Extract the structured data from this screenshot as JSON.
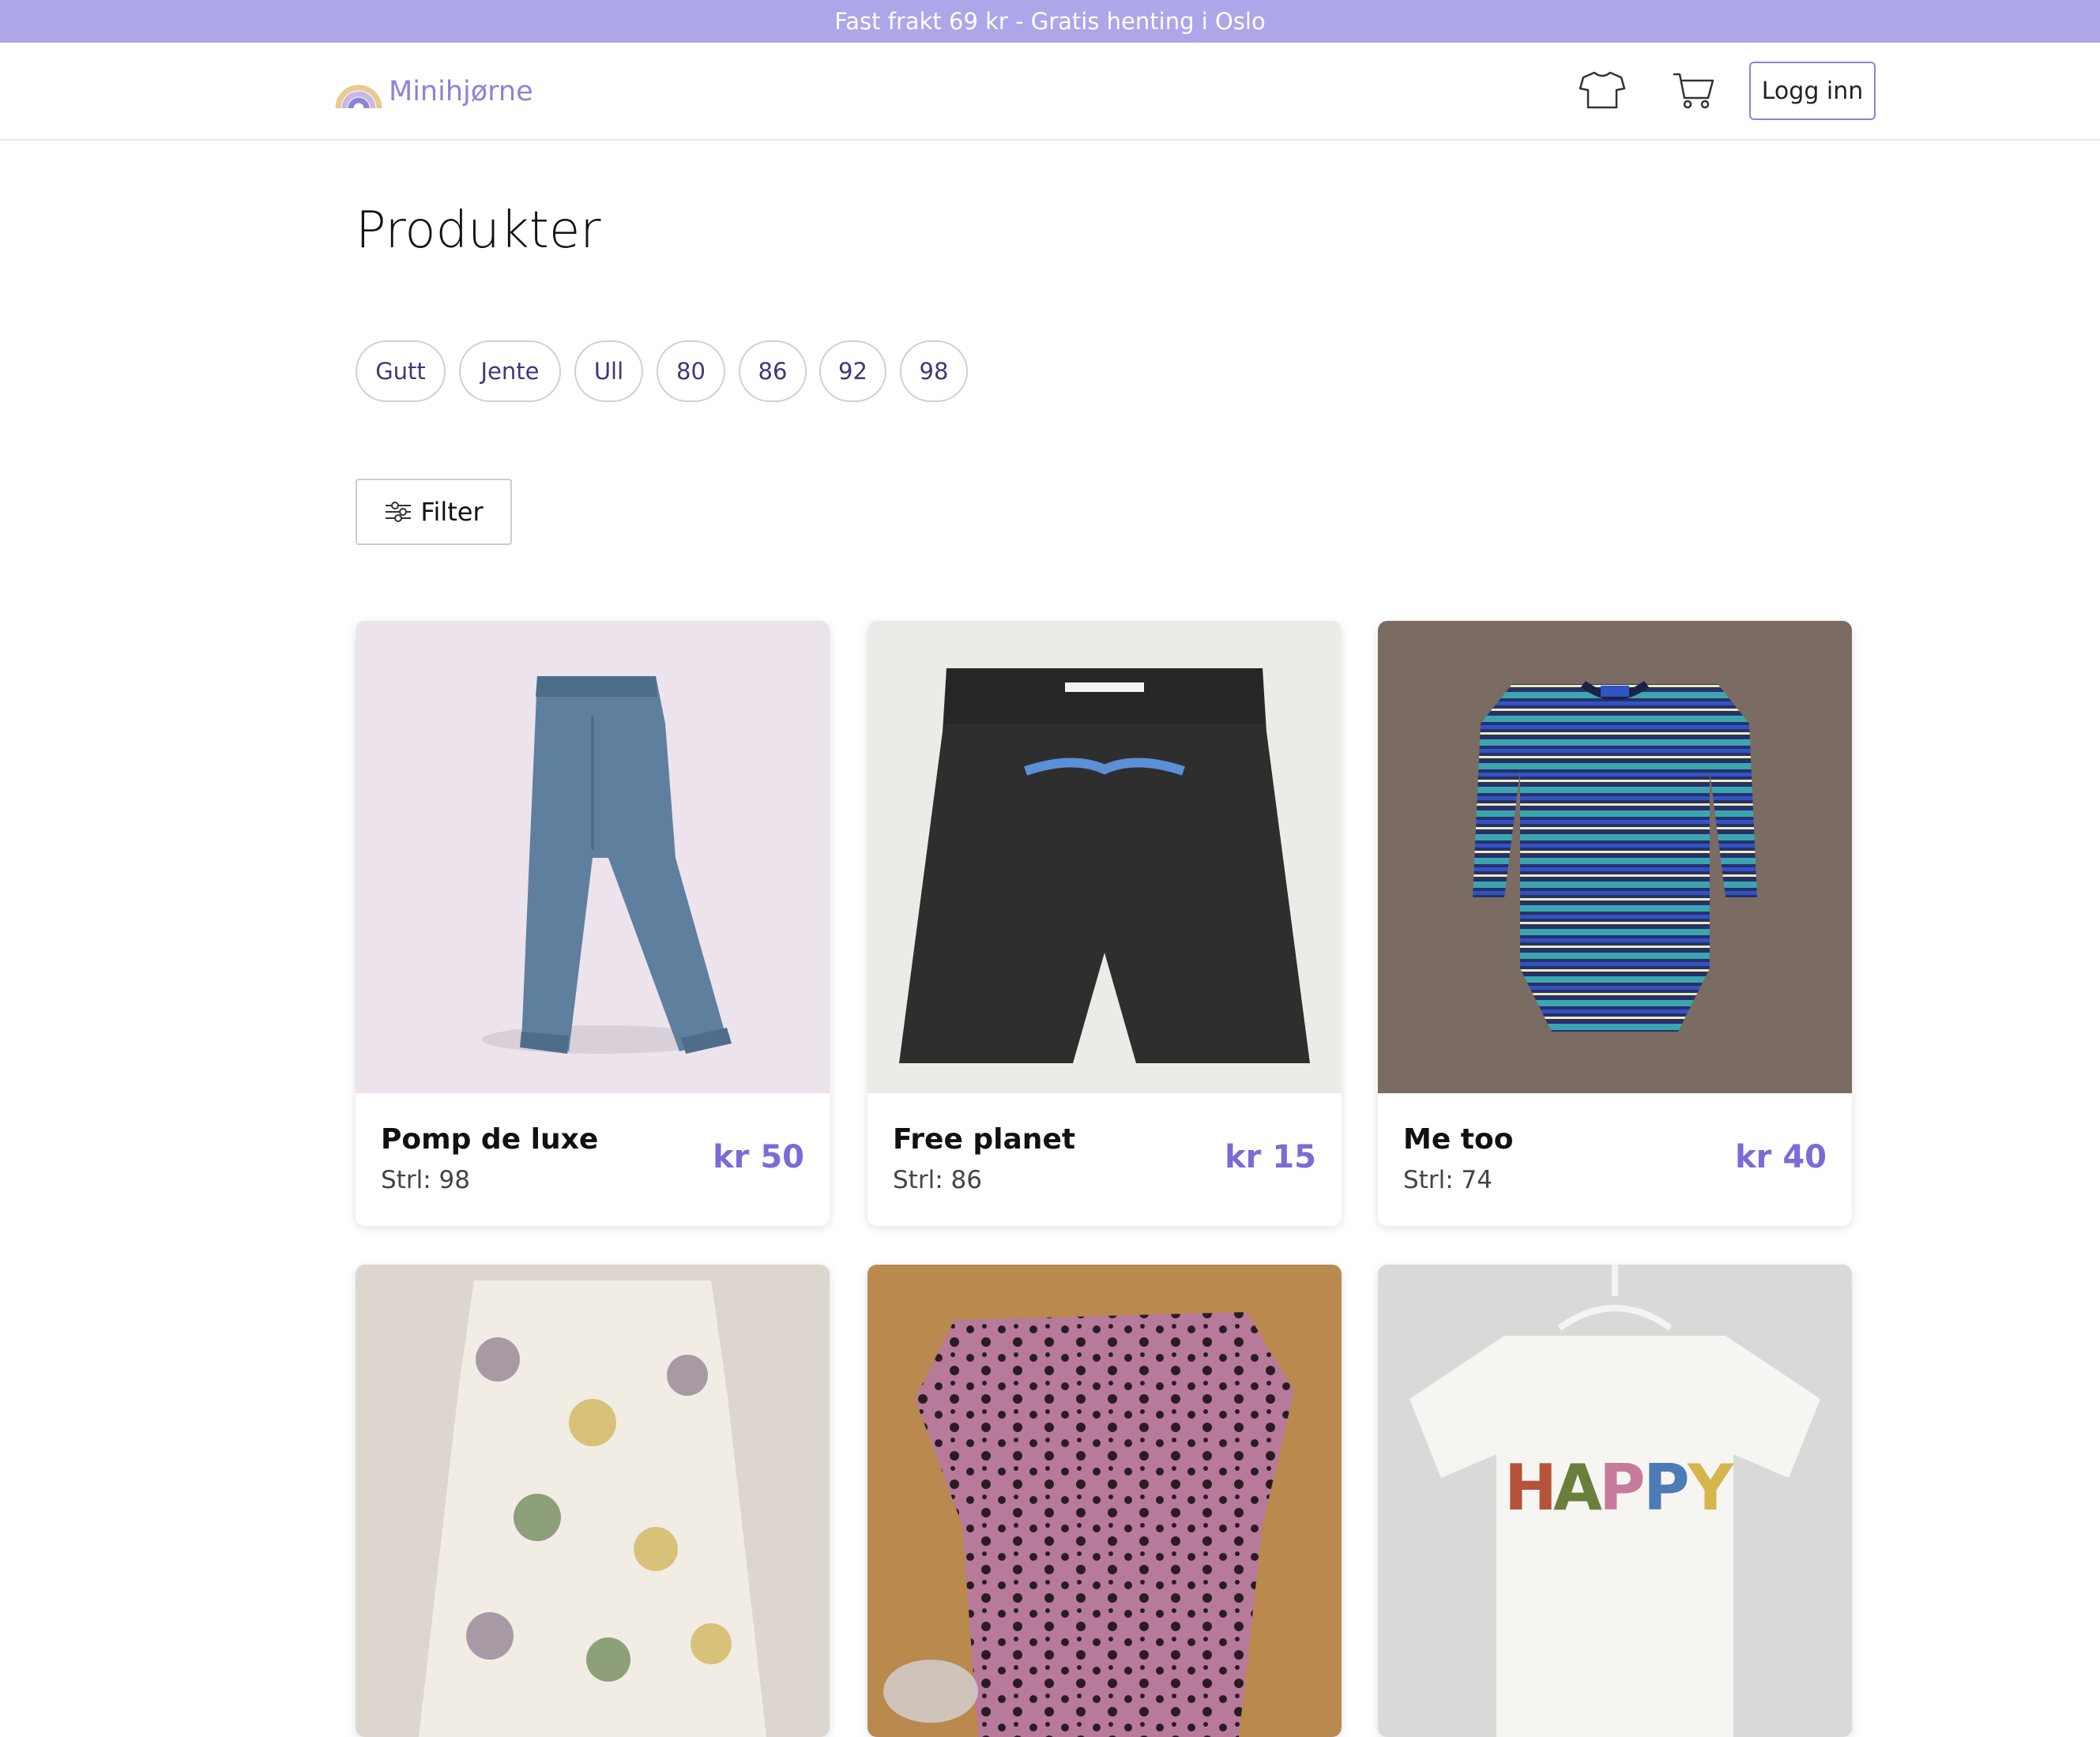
{
  "banner": {
    "text": "Fast frakt 69 kr - Gratis henting i Oslo"
  },
  "header": {
    "logo_text": "Minihjørne",
    "login_label": "Logg inn",
    "icons": [
      "tshirt-icon",
      "cart-icon"
    ]
  },
  "main": {
    "title": "Produkter",
    "chips": [
      "Gutt",
      "Jente",
      "Ull",
      "80",
      "86",
      "92",
      "98"
    ],
    "filter_label": "Filter"
  },
  "products": [
    {
      "name": "Pomp de luxe",
      "size": "Strl: 98",
      "price": "kr 50",
      "image": "denim-pants"
    },
    {
      "name": "Free planet",
      "size": "Strl: 86",
      "price": "kr 15",
      "image": "black-shorts"
    },
    {
      "name": "Me too",
      "size": "Strl: 74",
      "price": "kr 40",
      "image": "striped-bodysuit"
    },
    {
      "name": "",
      "size": "",
      "price": "",
      "image": "floral-dress"
    },
    {
      "name": "",
      "size": "",
      "price": "",
      "image": "leopard-top"
    },
    {
      "name": "",
      "size": "",
      "price": "",
      "image": "happy-tshirt"
    }
  ],
  "colors": {
    "banner": "#ada6e8",
    "accent": "#7b6bd6",
    "logo": "#8d83d8"
  }
}
